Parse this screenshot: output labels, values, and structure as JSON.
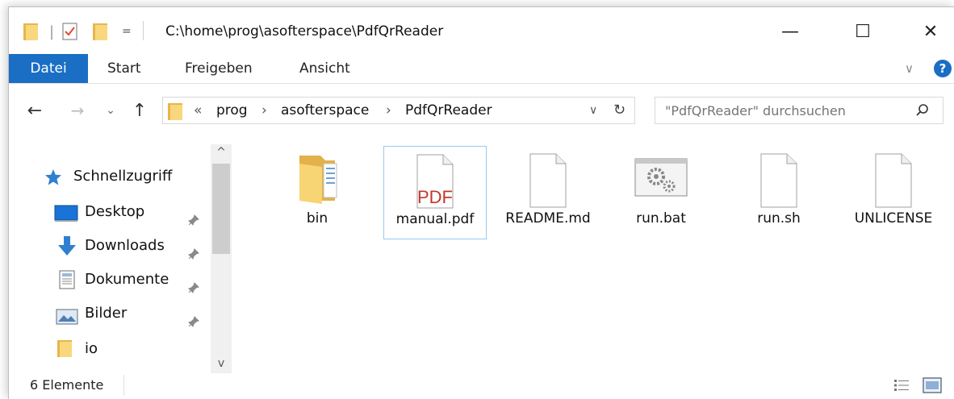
{
  "window": {
    "title": "C:\\home\\prog\\asofterspace\\PdfQrReader",
    "minimize_glyph": "—",
    "maximize_glyph": "☐",
    "close_glyph": "✕"
  },
  "quick_access_toolbar": {
    "separator": "|",
    "dropdown_glyph": "="
  },
  "ribbon": {
    "tabs": [
      "Datei",
      "Start",
      "Freigeben",
      "Ansicht"
    ],
    "expand_glyph": "∨",
    "help_glyph": "?"
  },
  "navigation": {
    "back_glyph": "←",
    "forward_glyph": "→",
    "recent_glyph": "⌄",
    "up_glyph": "↑",
    "overflow": "«",
    "path": [
      "prog",
      "asofterspace",
      "PdfQrReader"
    ],
    "separator": "›",
    "dropdown_glyph": "∨",
    "refresh_glyph": "↻",
    "search_placeholder": "\"PdfQrReader\" durchsuchen"
  },
  "nav_pane": {
    "items": [
      {
        "label": "Schnellzugriff",
        "icon": "star-icon"
      },
      {
        "label": "Desktop",
        "icon": "desktop-icon",
        "pinned": true
      },
      {
        "label": "Downloads",
        "icon": "download-icon",
        "pinned": true
      },
      {
        "label": "Dokumente",
        "icon": "document-icon",
        "pinned": true
      },
      {
        "label": "Bilder",
        "icon": "picture-icon",
        "pinned": true
      },
      {
        "label": "io",
        "icon": "folder-icon"
      }
    ],
    "scroll_up_glyph": "^",
    "scroll_down_glyph": "v"
  },
  "files": [
    {
      "name": "bin",
      "icon": "folder-icon",
      "selected": false
    },
    {
      "name": "manual.pdf",
      "icon": "pdf-file-icon",
      "badge": "PDF",
      "selected": true
    },
    {
      "name": "README.md",
      "icon": "file-icon",
      "selected": false
    },
    {
      "name": "run.bat",
      "icon": "batch-file-icon",
      "selected": false
    },
    {
      "name": "run.sh",
      "icon": "file-icon",
      "selected": false
    },
    {
      "name": "UNLICENSE",
      "icon": "file-icon",
      "selected": false
    }
  ],
  "status": {
    "item_count": "6 Elemente"
  },
  "colors": {
    "accent": "#1a6ec4",
    "folder": "#f9d77d",
    "folder_dark": "#e6b64b",
    "selection_border": "#99c9ef",
    "pdf_text": "#c0392b"
  }
}
